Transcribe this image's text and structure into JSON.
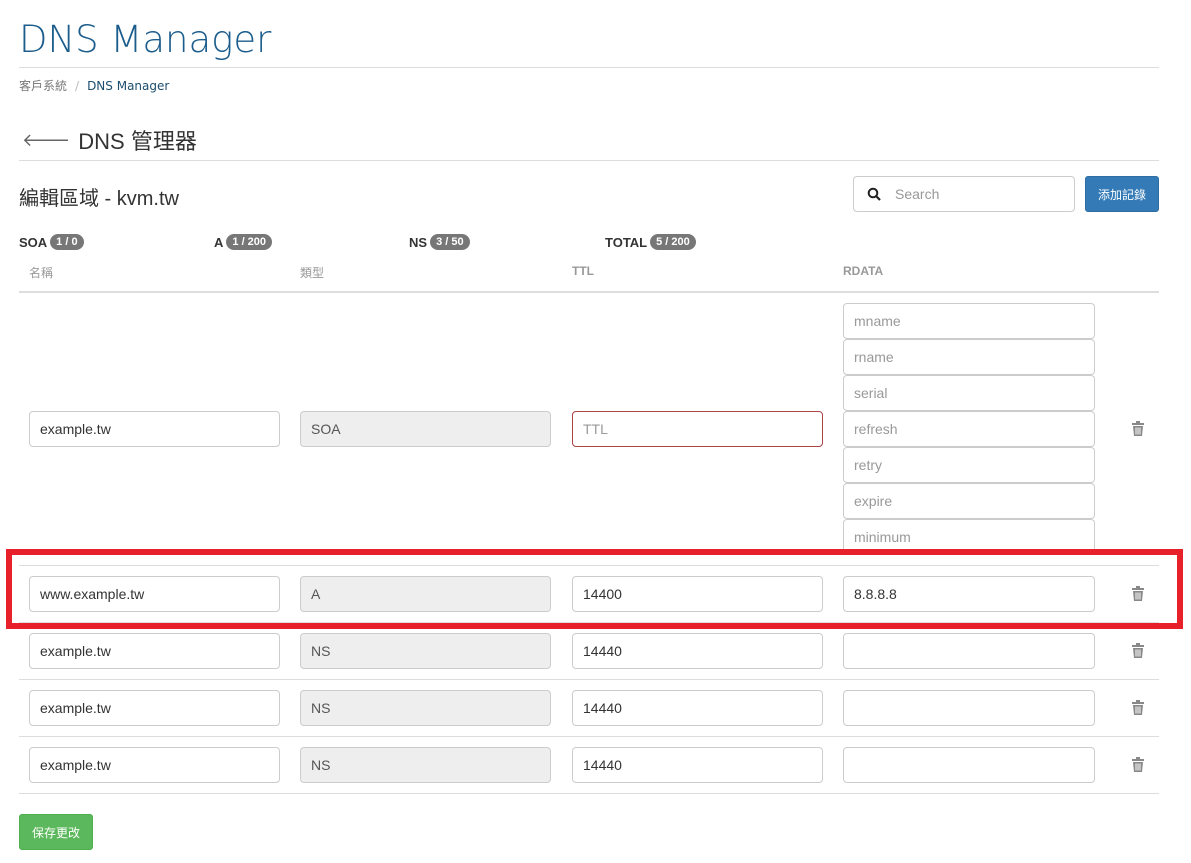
{
  "header": {
    "title": "DNS Manager"
  },
  "breadcrumb": [
    {
      "label": "客戶系統"
    },
    {
      "label": "DNS Manager"
    }
  ],
  "subheader": {
    "title": "DNS 管理器",
    "back_icon": "arrow-left-icon"
  },
  "zone": {
    "title": "編輯區域 - kvm.tw"
  },
  "search": {
    "placeholder": "Search",
    "icon": "search-icon"
  },
  "add_button": "添加記錄",
  "counts": [
    {
      "label": "SOA",
      "badge": "1 / 0"
    },
    {
      "label": "A",
      "badge": "1 / 200"
    },
    {
      "label": "NS",
      "badge": "3 / 50"
    },
    {
      "label": "TOTAL",
      "badge": "5 / 200"
    }
  ],
  "columns": [
    "名稱",
    "類型",
    "TTL",
    "RDATA"
  ],
  "soa": {
    "name": "example.tw",
    "type": "SOA",
    "ttl_placeholder": "TTL",
    "rdata_placeholders": [
      "mname",
      "rname",
      "serial",
      "refresh",
      "retry",
      "expire",
      "minimum"
    ]
  },
  "records": [
    {
      "name": "www.example.tw",
      "type": "A",
      "ttl": "14400",
      "rdata": "8.8.8.8",
      "highlighted": true
    },
    {
      "name": "example.tw",
      "type": "NS",
      "ttl": "14440",
      "rdata": ""
    },
    {
      "name": "example.tw",
      "type": "NS",
      "ttl": "14440",
      "rdata": ""
    },
    {
      "name": "example.tw",
      "type": "NS",
      "ttl": "14440",
      "rdata": ""
    }
  ],
  "save_button": "保存更改",
  "colors": {
    "primary": "#337ab7",
    "success": "#5cb85c",
    "highlight": "#e8202a",
    "title": "#1c5d8c"
  }
}
